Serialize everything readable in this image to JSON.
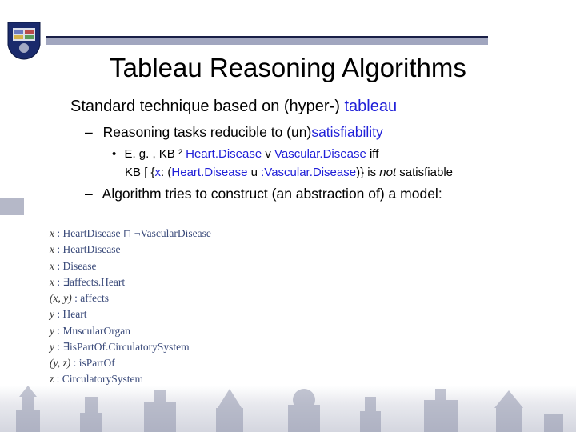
{
  "title": "Tableau Reasoning Algorithms",
  "intro_main": "Standard technique based on (hyper-) ",
  "intro_blue": "tableau",
  "bullets": {
    "b1_pre": "Reasoning tasks reducible to (un)",
    "b1_blue": "satisfiability",
    "b2_pre": "E. g. , KB ",
    "b2_sym1": "²",
    "b2_hd": " Heart.Disease ",
    "b2_v": "v",
    "b2_vd": " Vascular.Disease",
    "b2_iff": " iff",
    "b2b_kb": "KB ",
    "b2b_br": "[ ",
    "b2b_brace": "{",
    "b2b_x": "x",
    "b2b_col": ": (",
    "b2b_hd": "Heart.Disease ",
    "b2b_u": "u",
    "b2b_col2": " :",
    "b2b_vd": "Vascular.Disease",
    "b2b_close": ")} is ",
    "b2b_not": "not",
    "b2b_sat": " satisfiable",
    "b3": "Algorithm tries to construct (an abstraction of) a model:"
  },
  "model_rows": [
    {
      "var": "x",
      "rest": " : HeartDisease ⊓ ¬VascularDisease"
    },
    {
      "var": "x",
      "rest": " : HeartDisease"
    },
    {
      "var": "x",
      "rest": " : Disease"
    },
    {
      "var": "x",
      "rest": " : ∃affects.Heart"
    },
    {
      "var": "(x, y)",
      "rest": " : affects"
    },
    {
      "var": "y",
      "rest": " : Heart"
    },
    {
      "var": "y",
      "rest": " : MuscularOrgan"
    },
    {
      "var": "y",
      "rest": " : ∃isPartOf.CirculatorySystem"
    },
    {
      "var": "(y, z)",
      "rest": " : isPartOf"
    },
    {
      "var": "z",
      "rest": " : CirculatorySystem"
    }
  ]
}
